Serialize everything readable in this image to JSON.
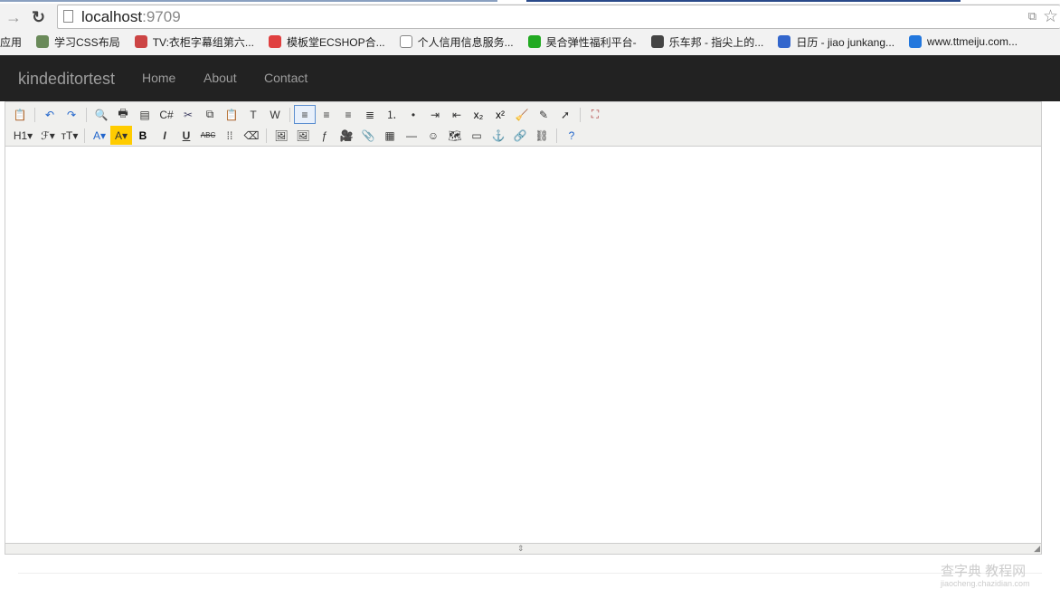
{
  "browser": {
    "url_host": "localhost",
    "url_port": ":9709",
    "bookmarks": [
      {
        "label": "应用",
        "icon": "apps-icon",
        "color": ""
      },
      {
        "label": "学习CSS布局",
        "icon": "pencil-site-icon",
        "color": "#6a8a5a"
      },
      {
        "label": "TV:衣柜字幕组第六...",
        "icon": "lion-site-icon",
        "color": "#cc4444"
      },
      {
        "label": "模板堂ECSHOP合...",
        "icon": "ec-site-icon",
        "color": "#e04040"
      },
      {
        "label": "个人信用信息服务...",
        "icon": "page-icon",
        "color": ""
      },
      {
        "label": "昊合弹性福利平台-",
        "icon": "green-hex-icon",
        "color": "#22aa22"
      },
      {
        "label": "乐车邦 - 指尖上的...",
        "icon": "lechebang-icon",
        "color": "#444444"
      },
      {
        "label": "日历 - jiao junkang...",
        "icon": "calendar-icon",
        "color": "#3366cc"
      },
      {
        "label": "www.ttmeiju.com...",
        "icon": "ttmeiju-icon",
        "color": "#2277dd"
      }
    ]
  },
  "navbar": {
    "brand": "kindeditortest",
    "links": [
      "Home",
      "About",
      "Contact"
    ]
  },
  "toolbar": {
    "row1": [
      [
        "source",
        "📋"
      ],
      "|",
      [
        "undo",
        "↶"
      ],
      [
        "redo",
        "↷"
      ],
      "|",
      [
        "preview",
        "🔍"
      ],
      [
        "print",
        "🖶"
      ],
      [
        "template",
        "▤"
      ],
      [
        "code",
        "C#"
      ],
      [
        "cut",
        "✂"
      ],
      [
        "copy",
        "⧉"
      ],
      [
        "paste",
        "📋"
      ],
      [
        "plainpaste",
        "T"
      ],
      [
        "wordpaste",
        "W"
      ],
      "|",
      [
        "justifyleft",
        "≡",
        1
      ],
      [
        "justifycenter",
        "≡"
      ],
      [
        "justifyright",
        "≡"
      ],
      [
        "justifyfull",
        "≣"
      ],
      [
        "insertorderedlist",
        "⒈"
      ],
      [
        "insertunorderedlist",
        "•"
      ],
      [
        "indent",
        "⇥"
      ],
      [
        "outdent",
        "⇤"
      ],
      [
        "subscript",
        "x₂"
      ],
      [
        "superscript",
        "x²"
      ],
      [
        "clearhtml",
        "🧹"
      ],
      [
        "quickformat",
        "✎"
      ],
      [
        "selectall",
        "➚"
      ],
      "|",
      [
        "fullscreen",
        "⛶"
      ]
    ],
    "row2": [
      [
        "formatblock",
        "H1▾",
        0,
        1
      ],
      [
        "fontname",
        "ℱ▾"
      ],
      [
        "fontsize",
        "тT▾"
      ],
      "|",
      [
        "forecolor",
        "A▾"
      ],
      [
        "hilitecolor",
        "A▾"
      ],
      [
        "bold",
        "B"
      ],
      [
        "italic",
        "I"
      ],
      [
        "underline",
        "U"
      ],
      [
        "strikethrough",
        "ABC"
      ],
      [
        "lineheight",
        "⁞⁞"
      ],
      [
        "removeformat",
        "⌫"
      ],
      "|",
      [
        "image",
        "🖼"
      ],
      [
        "multiimage",
        "🖼"
      ],
      [
        "flash",
        "ƒ"
      ],
      [
        "media",
        "🎥"
      ],
      [
        "insertfile",
        "📎"
      ],
      [
        "table",
        "▦"
      ],
      [
        "hr",
        "—"
      ],
      [
        "emoticons",
        "☺"
      ],
      [
        "baidumap",
        "🗺"
      ],
      [
        "pagebreak",
        "▭"
      ],
      [
        "anchor",
        "⚓"
      ],
      [
        "link",
        "🔗"
      ],
      [
        "unlink",
        "⛓"
      ],
      "|",
      [
        "about",
        "?"
      ]
    ]
  },
  "watermark": {
    "line1": "查字典 教程网",
    "line2": "jiaocheng.chazidian.com"
  }
}
